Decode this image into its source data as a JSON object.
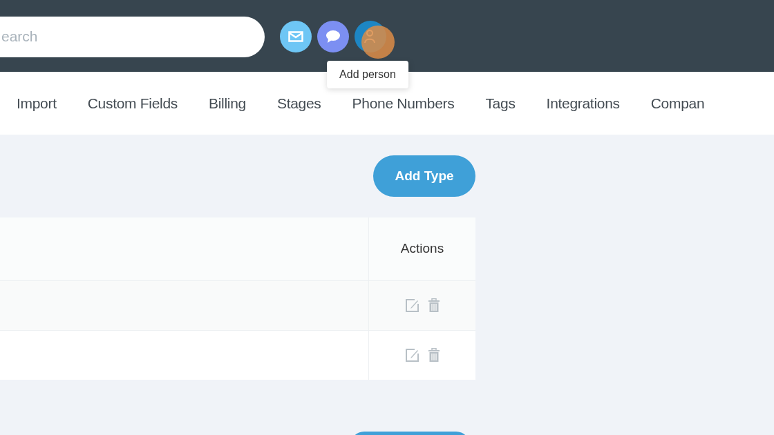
{
  "header": {
    "search": {
      "placeholder": "earch"
    },
    "icon_buttons": [
      {
        "kind": "mail",
        "color": "#6ec6f5"
      },
      {
        "kind": "chat",
        "color": "#7c8ff2"
      },
      {
        "kind": "person",
        "color": "#1d86c4"
      }
    ],
    "tooltip": "Add person"
  },
  "nav": {
    "items": [
      "Import",
      "Custom Fields",
      "Billing",
      "Stages",
      "Phone Numbers",
      "Tags",
      "Integrations",
      "Compan"
    ]
  },
  "add_button": "Add Type",
  "table": {
    "columns": [
      "",
      "Actions"
    ],
    "rows": [
      {
        "actions": [
          {
            "kind": "edit"
          },
          {
            "kind": "delete"
          }
        ]
      },
      {
        "actions": [
          {
            "kind": "edit"
          },
          {
            "kind": "delete"
          }
        ]
      }
    ]
  }
}
